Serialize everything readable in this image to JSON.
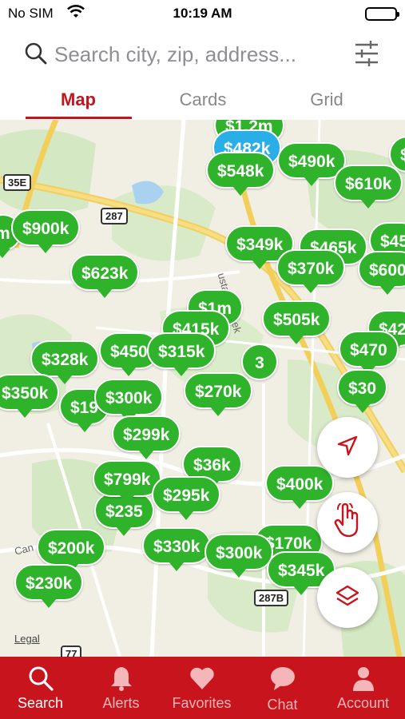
{
  "status_bar": {
    "carrier": "No SIM",
    "time": "10:19 AM"
  },
  "search": {
    "placeholder": "Search city, zip, address..."
  },
  "tabs": [
    {
      "label": "Map",
      "active": true
    },
    {
      "label": "Cards",
      "active": false
    },
    {
      "label": "Grid",
      "active": false
    }
  ],
  "map": {
    "road_shields": [
      "35E",
      "287",
      "287B",
      "77"
    ],
    "labels": [
      "ustang Creek",
      "Can",
      "Legal"
    ],
    "cluster_count": "3",
    "price_pins": [
      "$482k",
      "$548k",
      "$490k",
      "$610k",
      "$900k",
      "$349k",
      "$465k",
      "$45",
      "$623k",
      "$370k",
      "$600",
      "$1m",
      "$415k",
      "$505k",
      "$42",
      "$328k",
      "$450",
      "$315k",
      "$470",
      "$350k",
      "$19",
      "$300k",
      "$270k",
      "$30",
      "$299k",
      "$36k",
      "$799k",
      "$295k",
      "$400k",
      "$235",
      "$200k",
      "$330k",
      "$300k",
      "$170k",
      "$345k",
      "$230k",
      "m",
      "$1.2m"
    ]
  },
  "bottom_nav": [
    {
      "label": "Search",
      "icon": "search-icon",
      "active": true
    },
    {
      "label": "Alerts",
      "icon": "bell-icon",
      "active": false
    },
    {
      "label": "Favorites",
      "icon": "heart-icon",
      "active": false
    },
    {
      "label": "Chat",
      "icon": "chat-bubble-icon",
      "active": false
    },
    {
      "label": "Account",
      "icon": "person-icon",
      "active": false
    }
  ],
  "colors": {
    "brand_red": "#c8141c",
    "pin_green": "#2fb32a",
    "pin_blue": "#2aaee8",
    "active_tab": "#c0161f"
  }
}
